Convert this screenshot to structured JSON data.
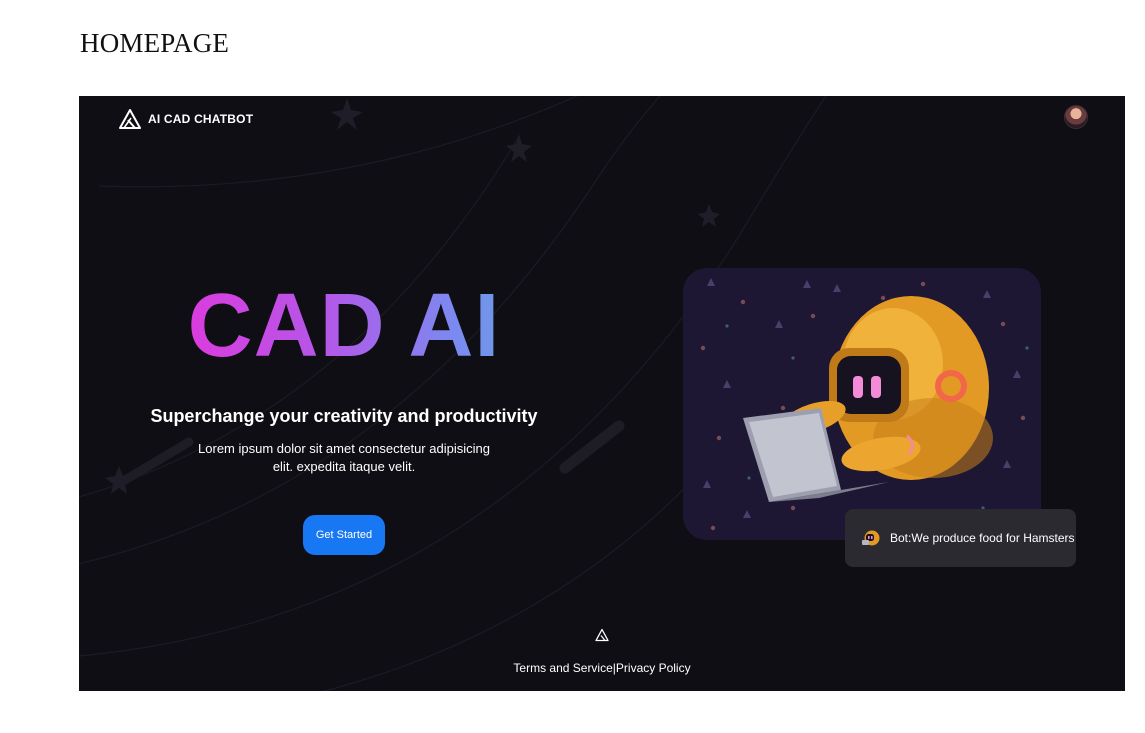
{
  "page": {
    "heading": "HOMEPAGE"
  },
  "header": {
    "brand_name": "AI CAD CHATBOT",
    "brand_icon": "triangle-logo-icon",
    "avatar_icon": "user-avatar"
  },
  "hero": {
    "title": "CAD AI",
    "subtitle": "Superchange your creativity and productivity",
    "description": "Lorem ipsum dolor sit amet consectetur adipisicing elit. expedita itaque velit.",
    "cta_label": "Get Started"
  },
  "illustration": {
    "subject": "robot-with-laptop-image"
  },
  "chat": {
    "message": "Bot:We produce food for Hamsters",
    "icon": "bot-avatar-icon"
  },
  "footer": {
    "terms_label": "Terms and Service",
    "separator": "|",
    "privacy_label": "Privacy Policy"
  },
  "colors": {
    "background": "#0f0e14",
    "accent_button": "#1877f2",
    "title_gradient_start": "#ee2fd9",
    "title_gradient_end": "#5aaede",
    "chat_bubble": "#2b2a30"
  }
}
